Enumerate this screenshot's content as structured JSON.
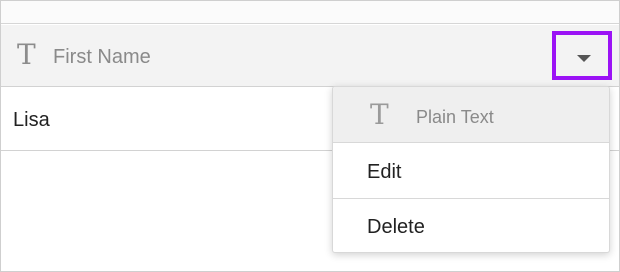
{
  "column": {
    "type_icon": "text-type-icon",
    "type_glyph": "T",
    "title": "First Name",
    "dropdown_icon": "caret-down-icon"
  },
  "rows": [
    {
      "first_name": "Lisa"
    }
  ],
  "menu": {
    "header_icon": "text-type-icon",
    "header_glyph": "T",
    "header_label": "Plain Text",
    "items": [
      {
        "label": "Edit"
      },
      {
        "label": "Delete"
      }
    ]
  },
  "colors": {
    "highlight": "#9b12f5",
    "header_bg": "#f3f3f3",
    "menu_header_bg": "#efefef"
  }
}
